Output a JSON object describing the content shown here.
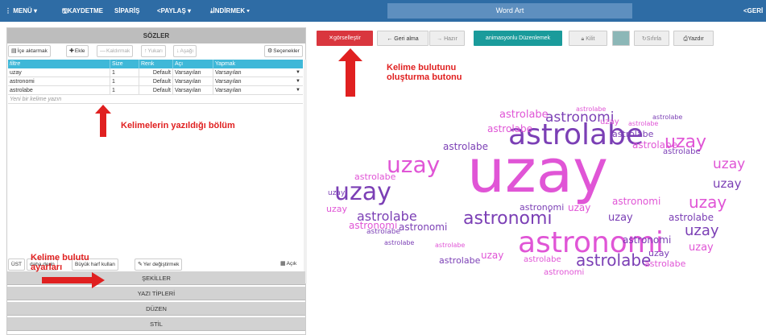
{
  "topbar": {
    "menu": "MENÜ",
    "save": "KAYDET",
    "order": "ME",
    "order2": "SİPARİŞ",
    "share": "PAYLAŞ",
    "download": "İNDİRMEK",
    "title": "Word Art",
    "back": "GERİ"
  },
  "left": {
    "section_title": "SÖZLER",
    "toolbar": {
      "import": "İçe aktarmak",
      "add": "Ekle",
      "remove": "Kaldırmak",
      "up": "Yukarı",
      "down": "Aşağı",
      "options": "Seçenekler"
    },
    "columns": [
      "filtre",
      "Size",
      "Renk",
      "Açı",
      "Yapmak"
    ],
    "rows": [
      [
        "uzay",
        "1",
        "Default",
        "Varsayılan",
        "Varsayılan"
      ],
      [
        "astronomi",
        "1",
        "Default",
        "Varsayılan",
        "Varsayılan"
      ],
      [
        "astrolabe",
        "1",
        "Default",
        "Varsayılan",
        "Varsayılan"
      ]
    ],
    "new_word_placeholder": "Yeni bir kelime yazın",
    "bottom_toolbar": {
      "ust": "ÜST",
      "add_more": "daha derin",
      "uppercase": "Büyük harf kullan",
      "replace": "Yer değiştirmek",
      "open": "Açık"
    },
    "accordion": [
      "ŞEKİLLER",
      "YAZI TİPLERİ",
      "DÜZEN",
      "STİL"
    ]
  },
  "right": {
    "toolbar": {
      "visualize": "görselleştir",
      "undo": "Geri alma",
      "redo": "Hazır",
      "animation": "animasyonlu Düzenlemek",
      "lock": "Kilit",
      "reset": "Sıfırla",
      "print": "Yazdır"
    }
  },
  "annotations": {
    "cloud_button": [
      "Kelime bulutunu",
      "oluşturma butonu"
    ],
    "words_section": "Kelimelerin yazıldığı bölüm",
    "cloud_settings": [
      "Kelime bulutu",
      "ayarları"
    ]
  },
  "colors": {
    "navbar": "#2e6ca5",
    "accent_red": "#d9363e",
    "teal": "#1a9b9b",
    "grid_header": "#3fb8d8",
    "annotation": "#e02020",
    "cloud_pink": "#e055d6",
    "cloud_purple": "#7b3fb5"
  },
  "cloud": {
    "words": [
      "uzay",
      "astronomi",
      "astrolabe"
    ]
  }
}
